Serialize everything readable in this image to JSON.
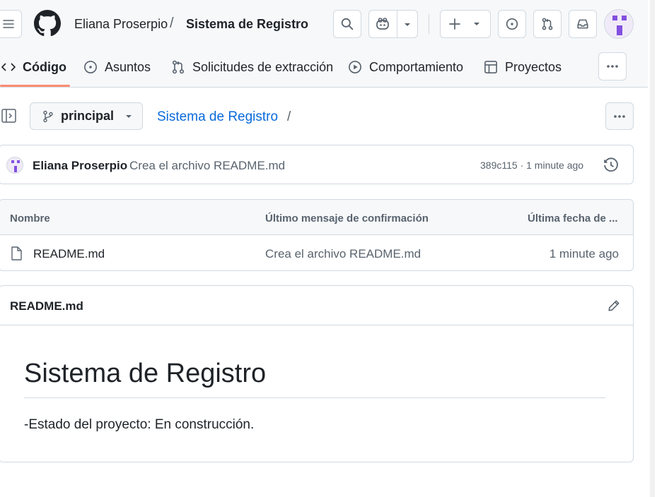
{
  "header": {
    "owner": "Eliana Proserpio",
    "separator": "/",
    "repo": "Sistema de Registro"
  },
  "tabs": [
    {
      "label": "Código",
      "icon": "code-icon",
      "selected": true
    },
    {
      "label": "Asuntos",
      "icon": "issue-opened-icon"
    },
    {
      "label": "Solicitudes de extracción",
      "icon": "git-pull-request-icon"
    },
    {
      "label": "Comportamiento",
      "icon": "play-icon"
    },
    {
      "label": "Proyectos",
      "icon": "table-icon"
    }
  ],
  "repo_bar": {
    "branch": "principal",
    "path_repo": "Sistema de Registro",
    "path_sep": "/"
  },
  "commit": {
    "author": "Eliana Proserpio",
    "message": "Crea el archivo README.md",
    "meta": "389c115 · 1 minute ago"
  },
  "files": {
    "headers": {
      "name": "Nombre",
      "message": "Último mensaje de confirmación",
      "date": "Última fecha de ..."
    },
    "rows": [
      {
        "name": "README.md",
        "message": "Crea el archivo README.md",
        "date": "1 minute ago"
      }
    ]
  },
  "readme": {
    "file_title": "README.md",
    "heading": "Sistema de Registro",
    "paragraph": "-Estado del proyecto: En construcción."
  },
  "colors": {
    "accent_link": "#0969da",
    "tab_underline": "#fd8c73",
    "avatar_purple": "#8250df"
  }
}
